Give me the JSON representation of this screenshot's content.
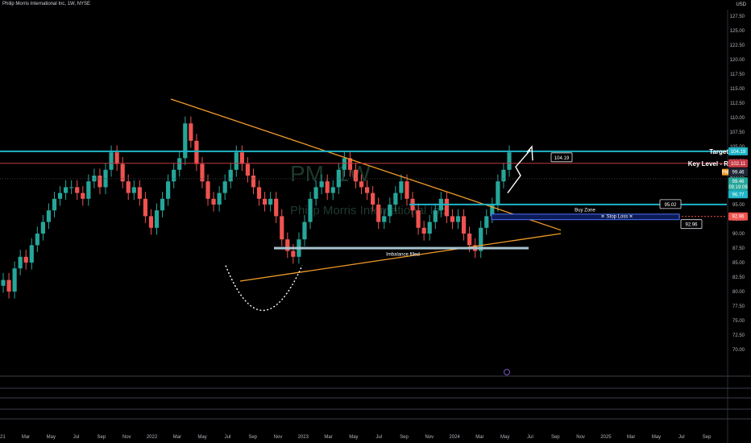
{
  "header": {
    "title": "Philip Morris International Inc, 1W, NYSE",
    "currency": "USD"
  },
  "watermark": {
    "symbol": "PM, 1W",
    "name": "Philip Morris International Inc"
  },
  "colors": {
    "up": "#26a69a",
    "down": "#ef5350",
    "trend": "#f39c29",
    "target": "#1fb5c7",
    "key": "#c63b46",
    "stop": "#ef5350",
    "zone": "#2962ff"
  },
  "chart_data": {
    "type": "candlestick",
    "ylim": [
      67.5,
      130
    ],
    "y_ticks": [
      70,
      72.5,
      75,
      77.5,
      80,
      82.5,
      85,
      87.5,
      90,
      92.5,
      95,
      97.5,
      100,
      102.5,
      105,
      107.5,
      110,
      112.5,
      115,
      117.5,
      120,
      122.5,
      125,
      127.5
    ],
    "x_ticks": [
      "Mar",
      "May",
      "Jul",
      "Sep",
      "Nov",
      "2022",
      "Mar",
      "May",
      "Jul",
      "Sep",
      "Nov",
      "2023",
      "Mar",
      "May",
      "Jul",
      "Sep",
      "Nov",
      "2024",
      "Mar",
      "May",
      "Jul",
      "Sep",
      "Nov",
      "2025",
      "Mar",
      "May",
      "Jul",
      "Sep"
    ],
    "x_ticks_left_fragment": "21",
    "series": [
      {
        "name": "PM",
        "close": [
          82,
          80,
          84,
          86,
          85,
          88,
          90,
          92,
          94,
          96,
          97,
          98,
          98,
          97,
          96,
          99,
          100,
          98,
          101,
          104,
          102,
          99,
          97,
          98,
          96,
          93,
          91,
          94,
          96,
          99,
          101,
          103,
          109,
          106,
          102,
          99,
          96,
          95,
          97,
          99,
          101,
          104,
          102,
          100,
          98,
          96,
          95,
          96,
          93,
          89,
          87,
          86,
          89,
          92,
          96,
          98,
          99,
          97,
          98,
          101,
          103,
          101,
          99,
          98,
          97,
          95,
          92,
          93,
          95,
          97,
          99,
          96,
          94,
          91,
          90,
          92,
          94,
          96,
          93,
          92,
          93,
          90,
          88,
          87,
          91,
          93,
          95,
          99,
          101,
          104
        ]
      }
    ],
    "price_labels": [
      {
        "value": 104.19,
        "text": "104.19"
      },
      {
        "value": 102.11,
        "text": "102.11"
      },
      {
        "value": 99.46,
        "text": "99.46"
      },
      {
        "value": 96.77,
        "text": "96.77"
      },
      {
        "value": 95.02,
        "text": "95.02"
      },
      {
        "value": 92.96,
        "text": "92.96"
      }
    ],
    "axis_tags": {
      "target": "104.19",
      "key": "102.11",
      "last": "99.46",
      "last_sub": "09:19:09",
      "mid": "96.77",
      "stop": "92.96",
      "mp": "PM"
    },
    "annotations": {
      "target": "Target",
      "key_level": "Key Level - R",
      "buy_zone": "Buy Zone",
      "stop_loss": "Stop Loss",
      "imbalance": "Imbalance filled",
      "level_95": "95.02",
      "level_9296": "92.96",
      "level_10419": "104.19"
    }
  }
}
